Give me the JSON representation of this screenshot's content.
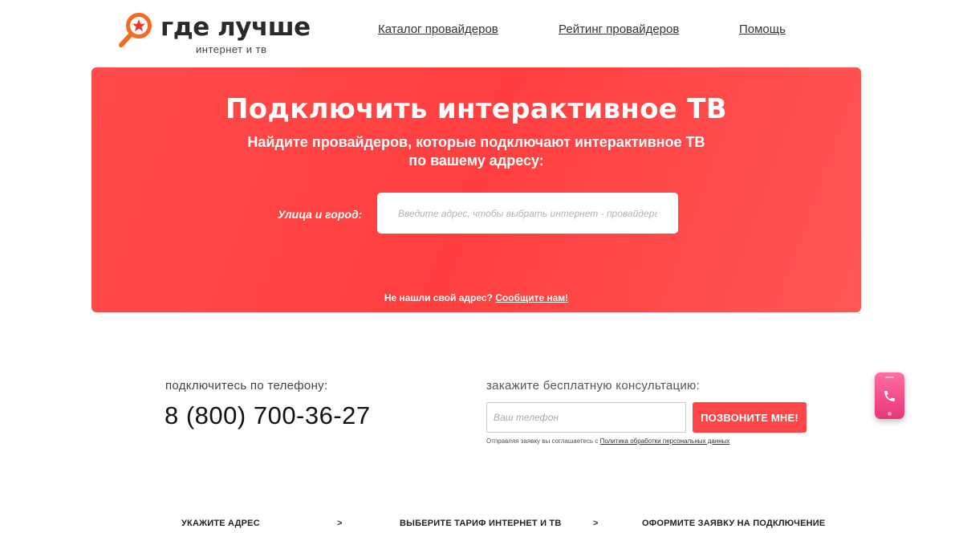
{
  "header": {
    "logo_title": "где лучше",
    "logo_subtitle": "интернет и тв",
    "nav": [
      "Каталог провайдеров",
      "Рейтинг провайдеров",
      "Помощь"
    ]
  },
  "hero": {
    "title": "Подключить интерактивное ТВ",
    "subtitle_line1": "Найдите провайдеров, которые подключают интерактивное ТВ",
    "subtitle_line2": "по вашему адресу:",
    "address_label": "Улица и город:",
    "address_placeholder": "Введите адрес, чтобы выбрать интернет - провайдера",
    "not_found_text": "Не нашли свой адрес?",
    "not_found_link": "Сообщите нам!"
  },
  "contact": {
    "phone_label": "подключитесь по телефону:",
    "phone_number": "8 (800) 700-36-27",
    "consult_label": "закажите бесплатную консультацию:",
    "phone_placeholder": "Ваш телефон",
    "call_button": "ПОЗВОНИТЕ МНЕ!",
    "consent_text": "Отправляя заявку вы соглашаетесь с",
    "consent_link": "Политика обработки персональных данных"
  },
  "steps": {
    "items": [
      "УКАЖИТЕ АДРЕС",
      "ВЫБЕРИТЕ ТАРИФ ИНТЕРНЕТ И ТВ",
      "ОФОРМИТЕ ЗАЯВКУ НА ПОДКЛЮЧЕНИЕ"
    ],
    "separator": ">"
  },
  "icons": {
    "logo": "magnifier-star-icon",
    "call_widget": "phone-icon"
  },
  "colors": {
    "accent": "#ff4545",
    "logo_orange": "#f26b21",
    "widget_pink": "#ec3d80"
  }
}
